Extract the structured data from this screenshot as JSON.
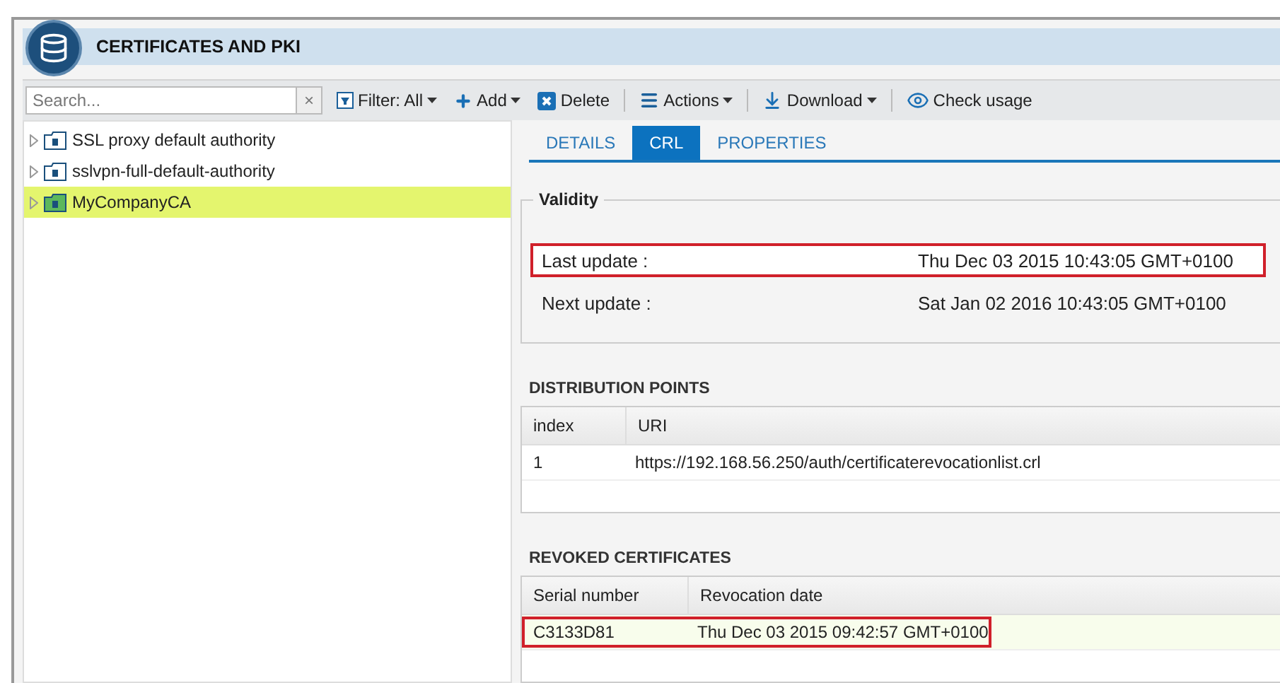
{
  "header": {
    "title": "CERTIFICATES AND PKI"
  },
  "toolbar": {
    "search": {
      "placeholder": "Search..."
    },
    "clear": "×",
    "items": [
      {
        "kind": "filter",
        "label": "Filter: All",
        "dropdown": true
      },
      {
        "kind": "add",
        "label": "Add",
        "dropdown": true
      },
      {
        "kind": "delete",
        "label": "Delete",
        "dropdown": false
      },
      {
        "kind": "actions",
        "label": "Actions",
        "dropdown": true
      },
      {
        "kind": "download",
        "label": "Download",
        "dropdown": true
      },
      {
        "kind": "check",
        "label": "Check usage",
        "dropdown": false
      }
    ]
  },
  "tree": [
    {
      "label": "SSL proxy default authority",
      "selected": false
    },
    {
      "label": "sslvpn-full-default-authority",
      "selected": false
    },
    {
      "label": "MyCompanyCA",
      "selected": true
    }
  ],
  "tabs": [
    {
      "label": "DETAILS",
      "selected": false
    },
    {
      "label": "CRL",
      "selected": true
    },
    {
      "label": "PROPERTIES",
      "selected": false
    }
  ],
  "validity": {
    "title": "Validity",
    "rows": [
      {
        "label": "Last update :",
        "value": "Thu Dec 03 2015 10:43:05 GMT+0100",
        "highlighted": true
      },
      {
        "label": "Next update :",
        "value": "Sat Jan 02 2016 10:43:05 GMT+0100",
        "highlighted": false
      }
    ]
  },
  "distribution_points": {
    "title": "DISTRIBUTION POINTS",
    "columns": [
      "index",
      "URI"
    ],
    "rows": [
      {
        "cells": [
          "1",
          "https://192.168.56.250/auth/certificaterevocationlist.crl"
        ],
        "highlighted": false
      }
    ]
  },
  "revoked_certificates": {
    "title": "REVOKED CERTIFICATES",
    "columns": [
      "Serial number",
      "Revocation date"
    ],
    "rows": [
      {
        "cells": [
          "C3133D81",
          "Thu Dec 03 2015 09:42:57 GMT+0100"
        ],
        "highlighted": true
      }
    ]
  }
}
